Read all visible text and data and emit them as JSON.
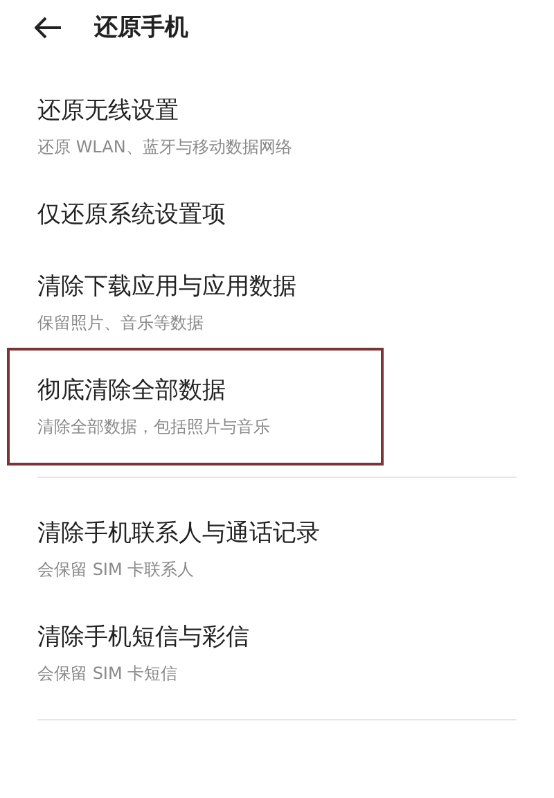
{
  "header": {
    "title": "还原手机"
  },
  "sections": [
    {
      "items": [
        {
          "title": "还原无线设置",
          "subtitle": "还原 WLAN、蓝牙与移动数据网络",
          "highlighted": false
        },
        {
          "title": "仅还原系统设置项",
          "highlighted": false
        },
        {
          "title": "清除下载应用与应用数据",
          "subtitle": "保留照片、音乐等数据",
          "highlighted": false
        },
        {
          "title": "彻底清除全部数据",
          "subtitle": "清除全部数据，包括照片与音乐",
          "highlighted": true
        }
      ]
    },
    {
      "items": [
        {
          "title": "清除手机联系人与通话记录",
          "subtitle": "会保留 SIM 卡联系人",
          "highlighted": false
        },
        {
          "title": "清除手机短信与彩信",
          "subtitle": "会保留 SIM 卡短信",
          "highlighted": false
        }
      ]
    }
  ]
}
